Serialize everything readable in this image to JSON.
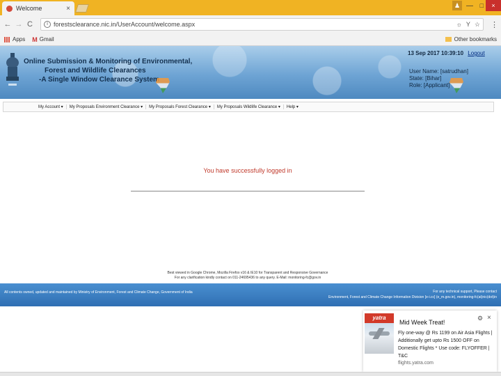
{
  "browser": {
    "tab_title": "Welcome",
    "tab_close": "×",
    "window_controls": {
      "user": "♟",
      "minimize": "—",
      "maximize": "□",
      "close": "×"
    },
    "nav": {
      "back": "←",
      "forward": "→",
      "reload": "C"
    },
    "info_glyph": "i",
    "url": "forestsclearance.nic.in/UserAccount/welcome.aspx",
    "omnibox_icons": {
      "key": "☼",
      "filter": "Y",
      "star": "☆"
    },
    "menu_glyph": "⋮",
    "bookmarks": {
      "apps": "Apps",
      "gmail_glyph": "M",
      "gmail": "Gmail",
      "other": "Other bookmarks"
    }
  },
  "header": {
    "title_lines": [
      "Online Submission & Monitoring of Environmental,",
      "Forest and Wildlife Clearances",
      "-A Single Window Clearance System"
    ],
    "datetime": "13 Sep 2017 10:39:10",
    "logout": "Logout",
    "user_name": "User Name: [satrudhan]",
    "state": "State: [Bihar]",
    "role": "Role: [Applicant]"
  },
  "menu": {
    "items": [
      "My Account",
      "My Proposals Environment Clearance",
      "My Proposals Forest Clearance",
      "My Proposals Wildlife Clearance",
      "Help"
    ]
  },
  "main": {
    "success_message": "You have successfully logged in",
    "best_view_line1": "Best viewed in Google Chrome, Mozilla Firefox v16 & IE10 for Transparent and Responsive Governance",
    "best_view_line2": "For any clarification kindly contact on 011-24695436 to any query. E-Mail: monitoring-fc@gov.in"
  },
  "footer": {
    "left": "All contents owned, updated and maintained by Ministry of Environment, Forest and Climate Change, Government of India",
    "right_line1": "For any technical support, Please contact",
    "right_line2": "Environment, Forest and Climate Change Information Division [e-i.cc] (e_m.gov.in), monitoring-fc(at)nic(dot)in"
  },
  "ad": {
    "logo": "yatra",
    "title": "Mid Week Treat!",
    "body": "Fly one-way @ Rs 1199 on Air Asia Flights | Additionally get upto Rs 1500 OFF on Domestic Flights * Use code: FLYOFFER | T&C",
    "domain": "flights.yatra.com",
    "gear_glyph": "⚙",
    "close_glyph": "×"
  },
  "colors": {
    "tab_strip": "#f0b323",
    "banner": "#6ea4d4",
    "footer": "#2f6fb3",
    "success_text": "#c0392b",
    "ad_brand": "#d23a2a"
  }
}
